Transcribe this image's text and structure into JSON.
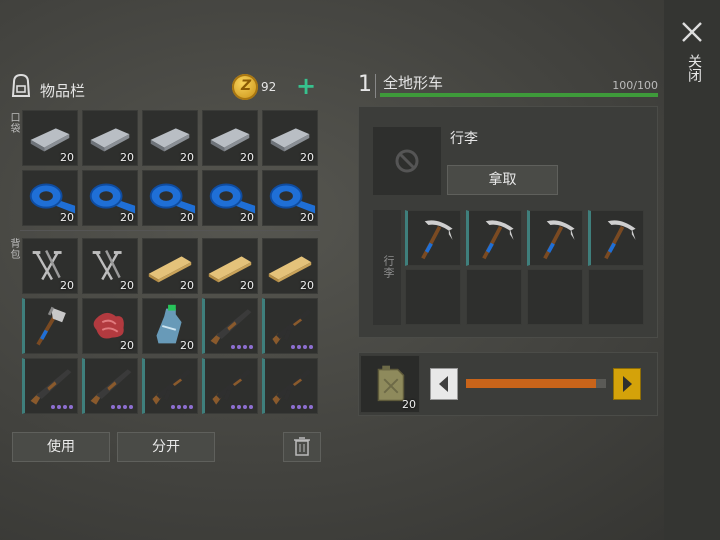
{
  "inventory": {
    "title": "物品栏",
    "coins": "92",
    "pocket_label": "口袋",
    "backpack_label": "背包",
    "pocket_slots": [
      {
        "icon": "metal-bar-icon",
        "count": "20"
      },
      {
        "icon": "metal-bar-icon",
        "count": "20"
      },
      {
        "icon": "metal-bar-icon",
        "count": "20"
      },
      {
        "icon": "metal-bar-icon",
        "count": "20"
      },
      {
        "icon": "metal-bar-icon",
        "count": "20"
      },
      {
        "icon": "duct-tape-icon",
        "count": "20"
      },
      {
        "icon": "duct-tape-icon",
        "count": "20"
      },
      {
        "icon": "duct-tape-icon",
        "count": "20"
      },
      {
        "icon": "duct-tape-icon",
        "count": "20"
      },
      {
        "icon": "duct-tape-icon",
        "count": "20"
      }
    ],
    "backpack_slots": [
      {
        "icon": "nails-icon",
        "count": "20"
      },
      {
        "icon": "nails-icon",
        "count": "20"
      },
      {
        "icon": "wood-plank-icon",
        "count": "20"
      },
      {
        "icon": "wood-plank-icon",
        "count": "20"
      },
      {
        "icon": "wood-plank-icon",
        "count": "20"
      },
      {
        "icon": "hatchet-icon",
        "count": ""
      },
      {
        "icon": "raw-meat-icon",
        "count": "20"
      },
      {
        "icon": "water-bottle-icon",
        "count": "20"
      },
      {
        "icon": "shotgun-icon",
        "count": ""
      },
      {
        "icon": "assault-rifle-icon",
        "count": ""
      },
      {
        "icon": "shotgun-icon",
        "count": ""
      },
      {
        "icon": "shotgun-icon",
        "count": ""
      },
      {
        "icon": "assault-rifle-icon",
        "count": ""
      },
      {
        "icon": "assault-rifle-icon",
        "count": ""
      },
      {
        "icon": "assault-rifle-icon",
        "count": ""
      }
    ],
    "use_label": "使用",
    "split_label": "分开"
  },
  "vehicle": {
    "number": "1",
    "name": "全地形车",
    "durability_text": "100/100",
    "durability_fraction": 1.0,
    "luggage_title": "行李",
    "take_label": "拿取",
    "luggage_side_label": "行李",
    "luggage_slots": [
      {
        "icon": "pickaxe-icon"
      },
      {
        "icon": "pickaxe-icon"
      },
      {
        "icon": "pickaxe-icon"
      },
      {
        "icon": "pickaxe-icon"
      },
      {
        "icon": ""
      },
      {
        "icon": ""
      },
      {
        "icon": ""
      },
      {
        "icon": ""
      }
    ],
    "fuel_count": "20",
    "fuel_fraction": 0.93
  },
  "close_label": "关闭",
  "colors": {
    "accent": "#3f7f7c",
    "durability": "#3e9a3a",
    "fuel": "#c9641a",
    "arrow": "#d4a20a"
  }
}
